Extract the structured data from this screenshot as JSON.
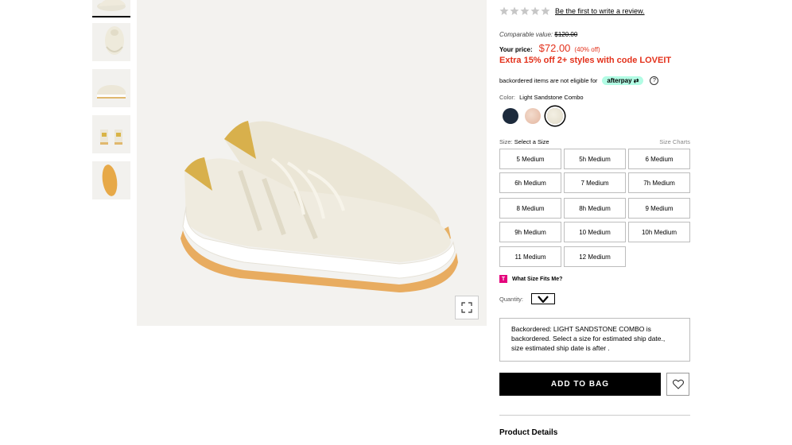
{
  "rating": {
    "review_link": "Be the first to write a review.",
    "star_icon": "star-icon",
    "star_color": "#c7c7c7"
  },
  "pricing": {
    "comparable_label": "Comparable value:",
    "comparable_value": "$120.00",
    "your_price_label": "Your price:",
    "price": "$72.00",
    "discount": "(40% off)",
    "promo": "Extra 15% off 2+ styles with code LOVEIT",
    "accent_color": "#e3311b"
  },
  "afterpay": {
    "text": "backordered items are not eligible for",
    "badge": "afterpay",
    "help_icon": "question-icon"
  },
  "color": {
    "label": "Color:",
    "value": "Light Sandstone Combo",
    "swatches": [
      {
        "name": "navy",
        "hex": "#1c2a3c"
      },
      {
        "name": "blush",
        "hex": "#e7c2b0"
      },
      {
        "name": "light sandstone",
        "hex": "#ebe6d8",
        "selected": true
      }
    ]
  },
  "size": {
    "label": "Size:",
    "value": "Select a Size",
    "charts_link": "Size Charts",
    "options": [
      "5 Medium",
      "5h Medium",
      "6 Medium",
      "6h Medium",
      "7 Medium",
      "7h Medium",
      "8 Medium",
      "8h Medium",
      "9 Medium",
      "9h Medium",
      "10 Medium",
      "10h Medium",
      "11 Medium",
      "12 Medium"
    ]
  },
  "fit": {
    "logo_letter": "T",
    "text": "What Size Fits Me?"
  },
  "quantity": {
    "label": "Quantity:",
    "icon": "chevron-down-icon"
  },
  "backorder_message": "Backordered: LIGHT SANDSTONE COMBO is backordered. Select a size for estimated ship date., size estimated ship date is after .",
  "actions": {
    "add_to_bag": "ADD TO BAG",
    "wishlist_icon": "heart-icon"
  },
  "details": {
    "title": "Product Details"
  },
  "gallery": {
    "thumbnail_count": 5,
    "zoom_icon": "expand-icon"
  }
}
